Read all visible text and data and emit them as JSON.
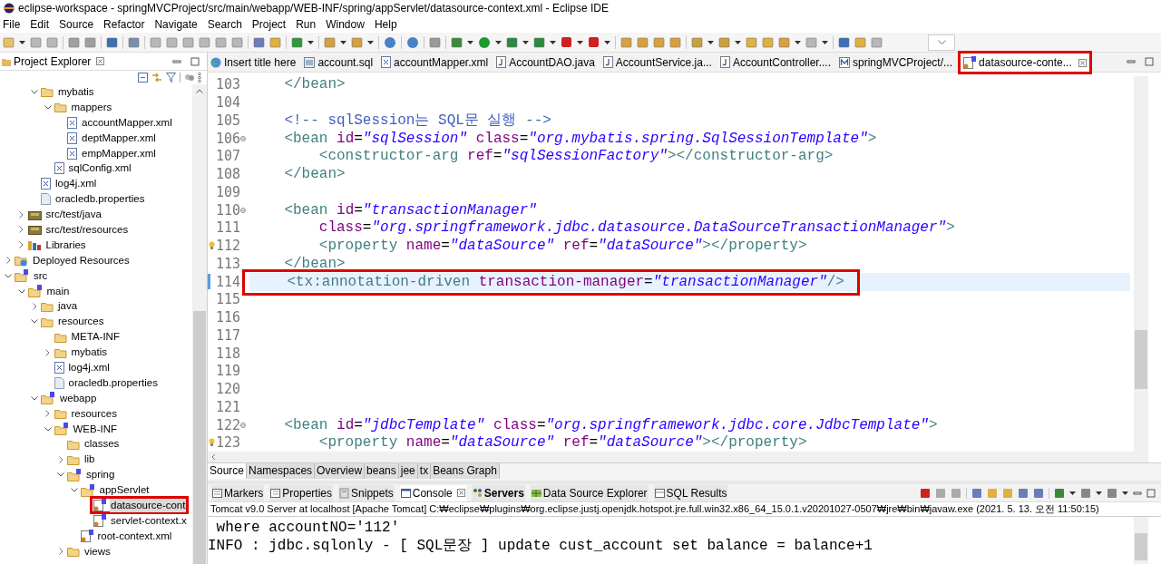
{
  "window": {
    "title": "eclipse-workspace - springMVCProject/src/main/webapp/WEB-INF/spring/appServlet/datasource-context.xml - Eclipse IDE"
  },
  "menu": [
    "File",
    "Edit",
    "Source",
    "Refactor",
    "Navigate",
    "Search",
    "Project",
    "Run",
    "Window",
    "Help"
  ],
  "explorer": {
    "title": "Project Explorer",
    "tree": [
      {
        "children": [
          {
            "children": [
              {
                "label": "mybatis",
                "kind": "folder",
                "expanded": true,
                "children": [
                  {
                    "label": "mappers",
                    "kind": "folder",
                    "expanded": true,
                    "children": [
                      {
                        "label": "accountMapper.xml",
                        "kind": "xml"
                      },
                      {
                        "label": "deptMapper.xml",
                        "kind": "xml"
                      },
                      {
                        "label": "empMapper.xml",
                        "kind": "xml"
                      }
                    ]
                  },
                  {
                    "label": "sqlConfig.xml",
                    "kind": "xml"
                  }
                ]
              },
              {
                "label": "log4j.xml",
                "kind": "xml"
              },
              {
                "label": "oracledb.properties",
                "kind": "file"
              }
            ]
          },
          {
            "label": "src/test/java",
            "kind": "package",
            "expanded": false
          },
          {
            "label": "src/test/resources",
            "kind": "package",
            "expanded": false
          },
          {
            "label": "Libraries",
            "kind": "library",
            "expanded": false
          }
        ]
      },
      {
        "label": "Deployed Resources",
        "kind": "deployed",
        "expanded": false
      },
      {
        "label": "src",
        "kind": "spring",
        "expanded": true,
        "children": [
          {
            "label": "main",
            "kind": "spring",
            "expanded": true,
            "children": [
              {
                "label": "java",
                "kind": "folder",
                "expanded": false
              },
              {
                "label": "resources",
                "kind": "folder",
                "expanded": true,
                "children": [
                  {
                    "label": "META-INF",
                    "kind": "folder"
                  },
                  {
                    "label": "mybatis",
                    "kind": "folder",
                    "expanded": false
                  },
                  {
                    "label": "log4j.xml",
                    "kind": "xml"
                  },
                  {
                    "label": "oracledb.properties",
                    "kind": "file"
                  }
                ]
              },
              {
                "label": "webapp",
                "kind": "spring",
                "expanded": true,
                "children": [
                  {
                    "label": "resources",
                    "kind": "folder",
                    "expanded": false
                  },
                  {
                    "label": "WEB-INF",
                    "kind": "spring",
                    "expanded": true,
                    "children": [
                      {
                        "label": "classes",
                        "kind": "folder"
                      },
                      {
                        "label": "lib",
                        "kind": "folder",
                        "expanded": false
                      },
                      {
                        "label": "spring",
                        "kind": "spring",
                        "expanded": true,
                        "children": [
                          {
                            "label": "appServlet",
                            "kind": "spring",
                            "expanded": true,
                            "children": [
                              {
                                "label": "datasource-cont",
                                "kind": "springxml",
                                "selected": true,
                                "highlighted": true
                              },
                              {
                                "label": "servlet-context.x",
                                "kind": "springxml",
                                "selected": false
                              }
                            ]
                          },
                          {
                            "label": "root-context.xml",
                            "kind": "springxml",
                            "selected": false
                          }
                        ]
                      },
                      {
                        "label": "views",
                        "kind": "folder",
                        "expanded": false
                      }
                    ]
                  }
                ]
              }
            ]
          }
        ]
      }
    ]
  },
  "editor": {
    "tabs": [
      {
        "label": "Insert title here",
        "kind": "globe",
        "selected": false
      },
      {
        "label": "account.sql",
        "kind": "sql",
        "selected": false
      },
      {
        "label": "accountMapper.xml",
        "kind": "xml",
        "selected": false
      },
      {
        "label": "AccountDAO.java",
        "kind": "java",
        "selected": false
      },
      {
        "label": "AccountService.ja...",
        "kind": "java",
        "selected": false
      },
      {
        "label": "AccountController....",
        "kind": "java",
        "selected": false
      },
      {
        "label": "springMVCProject/...",
        "kind": "maven",
        "selected": false
      },
      {
        "label": "datasource-conte...",
        "kind": "springxml",
        "selected": true,
        "highlighted": true
      }
    ],
    "lines": [
      {
        "number": "103",
        "text": "    </bean>"
      },
      {
        "number": "104"
      },
      {
        "number": "105",
        "text": "    <!-- sqlSession는 SQL문 실행 -->"
      },
      {
        "number": "106",
        "foldable": true,
        "text": "    <bean id=\"sqlSession\" class=\"org.mybatis.spring.SqlSessionTemplate\">"
      },
      {
        "number": "107",
        "text": "        <constructor-arg ref=\"sqlSessionFactory\"></constructor-arg>"
      },
      {
        "number": "108",
        "text": "    </bean>"
      },
      {
        "number": "109"
      },
      {
        "number": "110",
        "foldable": true,
        "text": "    <bean id=\"transactionManager\""
      },
      {
        "number": "111",
        "text": "        class=\"org.springframework.jdbc.datasource.DataSourceTransactionManager\">"
      },
      {
        "number": "112",
        "warning": true,
        "text": "        <property name=\"dataSource\" ref=\"dataSource\"></property>"
      },
      {
        "number": "113",
        "text": "    </bean>"
      },
      {
        "number": "114",
        "current": true,
        "highlighted": true,
        "text": "    <tx:annotation-driven transaction-manager=\"transactionManager\"/>"
      },
      {
        "number": "115"
      },
      {
        "number": "116"
      },
      {
        "number": "117"
      },
      {
        "number": "118"
      },
      {
        "number": "119"
      },
      {
        "number": "120"
      },
      {
        "number": "121"
      },
      {
        "number": "122",
        "foldable": true,
        "text": "    <bean id=\"jdbcTemplate\" class=\"org.springframework.jdbc.core.JdbcTemplate\">"
      },
      {
        "number": "123",
        "warning": true,
        "text": "        <property name=\"dataSource\" ref=\"dataSource\"></property>"
      }
    ],
    "bottom_tabs": [
      {
        "label": "Source",
        "selected": true
      },
      {
        "label": "Namespaces",
        "selected": false
      },
      {
        "label": "Overview",
        "selected": false
      },
      {
        "label": "beans",
        "selected": false
      },
      {
        "label": "jee",
        "selected": false
      },
      {
        "label": "tx",
        "selected": false
      },
      {
        "label": "Beans Graph",
        "selected": false
      }
    ]
  },
  "console_view": {
    "tabs": [
      {
        "label": "Markers",
        "selected": false,
        "updated": false
      },
      {
        "label": "Properties",
        "selected": false,
        "updated": false
      },
      {
        "label": "Snippets",
        "selected": false,
        "updated": false
      },
      {
        "label": "Console",
        "selected": true,
        "updated": false
      },
      {
        "label": "Servers",
        "selected": false,
        "updated": true
      },
      {
        "label": "Data Source Explorer",
        "selected": false,
        "updated": false
      },
      {
        "label": "SQL Results",
        "selected": false,
        "updated": false
      }
    ],
    "launch": "Tomcat v9.0 Server at localhost [Apache Tomcat] C:₩eclipse₩plugins₩org.eclipse.justj.openjdk.hotspot.jre.full.win32.x86_64_15.0.1.v20201027-0507₩jre₩bin₩javaw.exe  (2021. 5. 13. 오전 11:50:15)",
    "output": [
      " where accountNO='112'",
      "INFO : jdbc.sqlonly - [ SQL문장 ] update cust_account set balance = balance+1"
    ]
  }
}
